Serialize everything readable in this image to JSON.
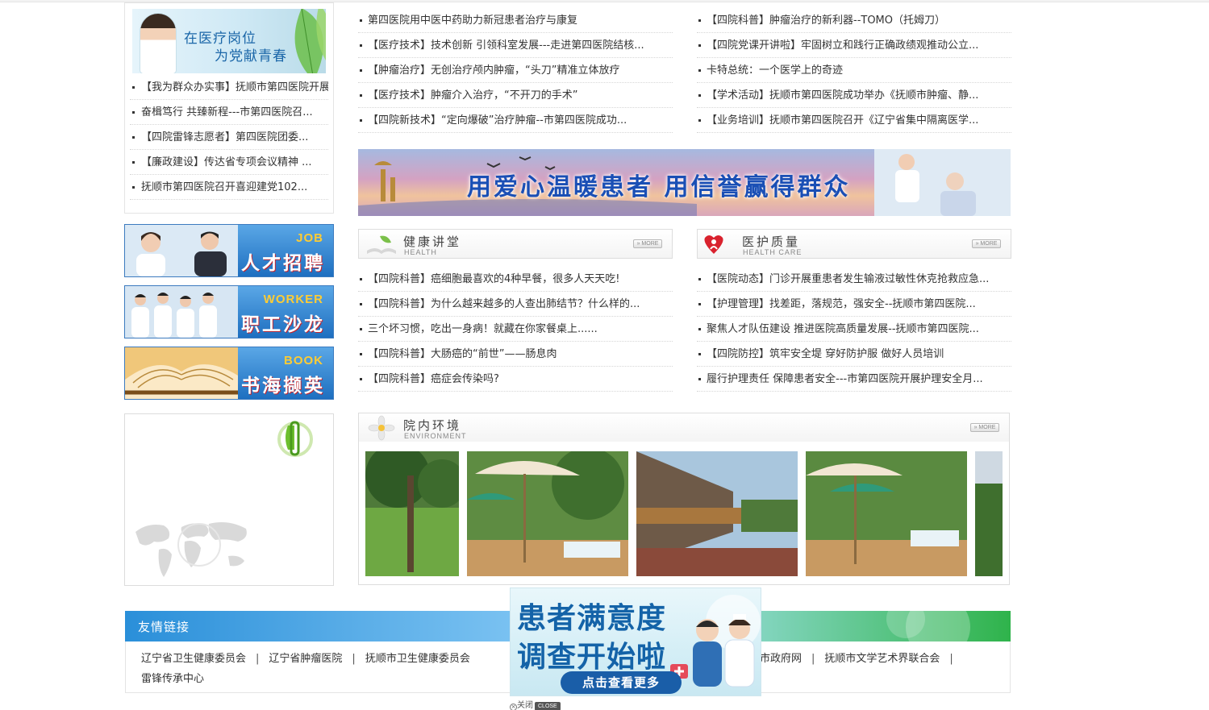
{
  "left": {
    "banner_line1": "在医疗岗位",
    "banner_line2": "为党献青春",
    "news": [
      "【我为群众办实事】抚顺市第四医院开展...",
      "奋楫笃行 共臻新程---市第四医院召...",
      "【四院雷锋志愿者】第四医院团委...",
      "【廉政建设】传达省专项会议精神 ...",
      "抚顺市第四医院召开喜迎建党102..."
    ],
    "side_banners": [
      {
        "en": "JOB",
        "cn": "人才招聘"
      },
      {
        "en": "WORKER",
        "cn": "职工沙龙"
      },
      {
        "en": "BOOK",
        "cn": "书海撷英"
      }
    ]
  },
  "news_left": [
    "第四医院用中医中药助力新冠患者治疗与康复",
    "【医疗技术】技术创新 引领科室发展---走进第四医院结核...",
    "【肿瘤治疗】无创治疗颅内肿瘤，“头刀”精准立体放疗",
    "【医疗技术】肿瘤介入治疗，“不开刀的手术”",
    "【四院新技术】“定向爆破”治疗肿瘤--市第四医院成功..."
  ],
  "news_right": [
    "【四院科普】肿瘤治疗的新利器--TOMO（托姆刀）",
    "【四院党课开讲啦】牢固树立和践行正确政绩观推动公立...",
    "卡特总统：一个医学上的奇迹",
    "【学术活动】抚顺市第四医院成功举办《抚顺市肿瘤、静...",
    "【业务培训】抚顺市第四医院召开《辽宁省集中隔离医学..."
  ],
  "banner": {
    "text": "用爱心温暖患者   用信誉赢得群众"
  },
  "health": {
    "title": "健康讲堂",
    "subtitle": "HEALTH",
    "more": "» MORE",
    "items": [
      "【四院科普】癌细胞最喜欢的4种早餐，很多人天天吃!",
      "【四院科普】为什么越来越多的人查出肺结节？什么样的...",
      "三个坏习惯，吃出一身病！就藏在你家餐桌上......",
      "【四院科普】大肠癌的“前世”——肠息肉",
      "【四院科普】癌症会传染吗?"
    ]
  },
  "care": {
    "title": "医护质量",
    "subtitle": "HEALTH CARE",
    "more": "» MORE",
    "items": [
      "【医院动态】门诊开展重患者发生输液过敏性休克抢救应急...",
      "【护理管理】找差距，落规范，强安全--抚顺市第四医院...",
      "聚焦人才队伍建设 推进医院高质量发展--抚顺市第四医院...",
      "【四院防控】筑牢安全堤 穿好防护服 做好人员培训",
      "履行护理责任 保障患者安全---市第四医院开展护理安全月..."
    ]
  },
  "environment": {
    "title": "院内环境",
    "subtitle": "ENVIRONMENT",
    "more": "» MORE"
  },
  "friends": {
    "title": "友情链接",
    "links_row1a": [
      "辽宁省卫生健康委员会",
      "辽宁省肿瘤医院",
      "抚顺市卫生健康委员会"
    ],
    "links_row1b": [
      "市政府网",
      "抚顺市文学艺术界联合会"
    ],
    "links_row2": [
      "雷锋传承中心"
    ]
  },
  "popup": {
    "line1": "患者满意度",
    "line2": "调查开始啦",
    "cta": "点击查看更多",
    "close_label": "关闭",
    "close_badge": "CLOSE"
  },
  "colors": {
    "link_bar_start": "#2a8fd9",
    "link_bar_end": "#2fb34b",
    "side_banner": "#1e6fc0",
    "popup_text": "#1463a8"
  }
}
